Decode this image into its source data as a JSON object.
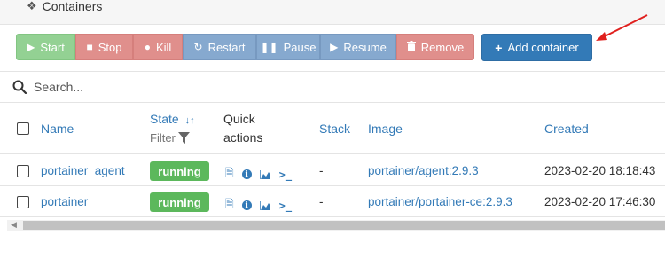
{
  "header": {
    "icon": "cubes-icon",
    "title": "Containers"
  },
  "toolbar": {
    "start_label": "Start",
    "stop_label": "Stop",
    "kill_label": "Kill",
    "restart_label": "Restart",
    "pause_label": "Pause",
    "resume_label": "Resume",
    "remove_label": "Remove",
    "add_label": "Add container"
  },
  "search": {
    "placeholder": "Search...",
    "value": ""
  },
  "table": {
    "columns": {
      "name": "Name",
      "state": "State",
      "state_sort_icon": "sort-alpha-icon",
      "filter": "Filter",
      "quick_actions_line1": "Quick",
      "quick_actions_line2": "actions",
      "stack": "Stack",
      "image": "Image",
      "created": "Created"
    },
    "rows": [
      {
        "name": "portainer_agent",
        "state": "running",
        "stack": "-",
        "image": "portainer/agent:2.9.3",
        "created": "2023-02-20 18:18:43"
      },
      {
        "name": "portainer",
        "state": "running",
        "stack": "-",
        "image": "portainer/portainer-ce:2.9.3",
        "created": "2023-02-20 17:46:30"
      }
    ]
  },
  "colors": {
    "primary": "#337ab7",
    "success": "#5cb85c",
    "danger_light": "#e08f8c",
    "success_light": "#93d193",
    "primary_light": "#86a9cf",
    "annotation_arrow": "#e0201e"
  }
}
